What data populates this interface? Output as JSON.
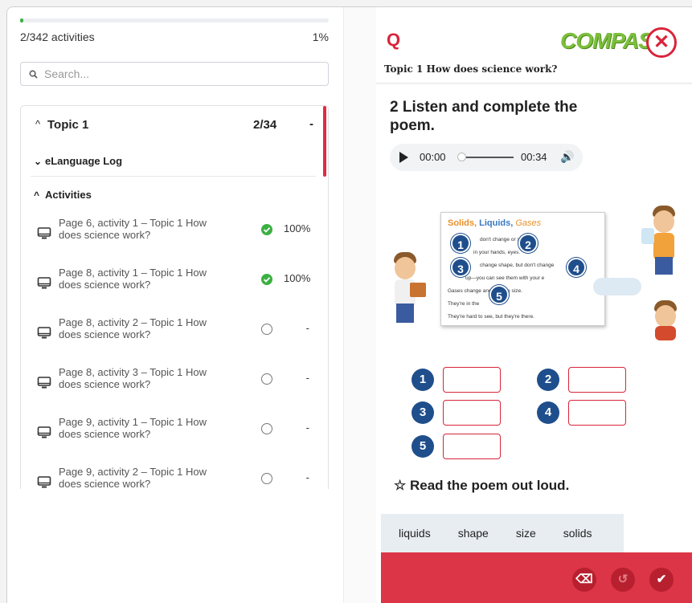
{
  "left": {
    "progress_percent": 1,
    "activities_count": "2/342 activities",
    "activities_pct": "1%",
    "search_placeholder": "Search...",
    "topic": {
      "title": "Topic 1",
      "count": "2/34",
      "dash": "-"
    },
    "log_label": "eLanguage Log",
    "activities_label": "Activities",
    "activities": [
      {
        "title": "Page 6, activity 1 – Topic 1 How does science work?",
        "status": "done",
        "score": "100%"
      },
      {
        "title": "Page 8, activity 1 – Topic 1 How does science work?",
        "status": "done",
        "score": "100%"
      },
      {
        "title": "Page 8, activity 2 – Topic 1 How does science work?",
        "status": "todo",
        "score": "-"
      },
      {
        "title": "Page 8, activity 3 – Topic 1 How does science work?",
        "status": "todo",
        "score": "-"
      },
      {
        "title": "Page 9, activity 1 – Topic 1 How does science work?",
        "status": "todo",
        "score": "-"
      },
      {
        "title": "Page 9, activity 2 – Topic 1 How does science work?",
        "status": "todo",
        "score": "-"
      }
    ]
  },
  "right": {
    "logo": "Q",
    "brand": "COMPASS",
    "close": "✕",
    "topic_title": "Topic 1 How does science work?",
    "heading_num": "2",
    "heading_text": "Listen and complete the poem.",
    "audio": {
      "current": "00:00",
      "duration": "00:34"
    },
    "poem": {
      "title_solids": "Solids,",
      "title_liquids": "Liquids,",
      "title_gases": "Gases",
      "lines": [
        "don't change        or size.",
        "in your hands,          eyes.",
        "change shape, but don't change",
        "up—you can see them with your e",
        "Gases change           and change size.",
        "They're in the",
        "They're hard to see, but they're there."
      ]
    },
    "numbers": [
      "1",
      "2",
      "3",
      "4",
      "5"
    ],
    "read_aloud": "☆ Read the poem out loud.",
    "word_bank": [
      "liquids",
      "shape",
      "size",
      "solids"
    ],
    "colors": {
      "accent_red": "#dc3547",
      "brand_green": "#7cbf3c",
      "number_blue": "#1f4e8c",
      "done_green": "#3cb043"
    }
  }
}
